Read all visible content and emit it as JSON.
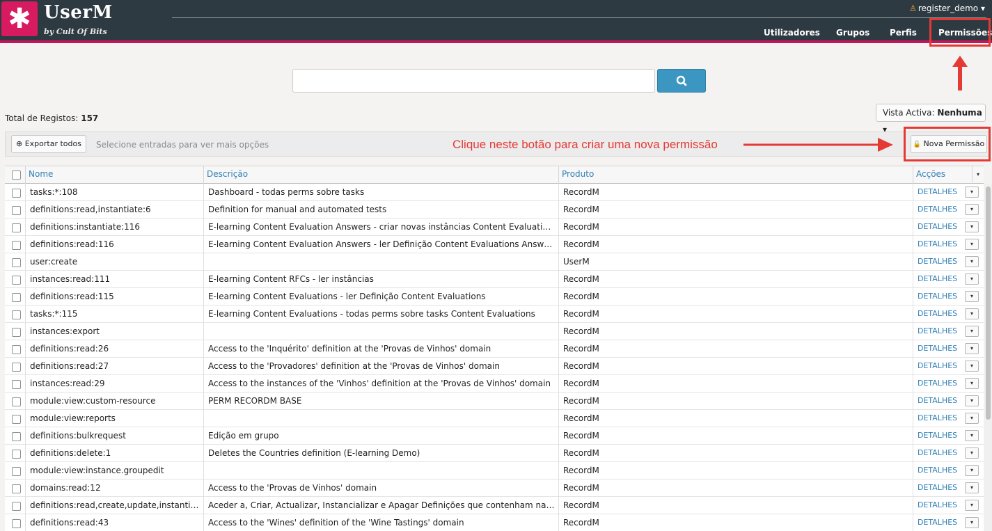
{
  "app": {
    "logo_glyph": "✱",
    "title": "UserM",
    "subtitle": "by Cult Of Bits",
    "user": "register_demo",
    "user_caret": "▾",
    "brand_color": "#d81b60",
    "header_color": "#2e3a42"
  },
  "nav": [
    {
      "label": "Utilizadores"
    },
    {
      "label": "Grupos"
    },
    {
      "label": "Perfis"
    },
    {
      "label": "Permissões"
    }
  ],
  "search": {
    "value": "",
    "placeholder": "",
    "icon": "search-icon"
  },
  "summary": {
    "total_label": "Total de Registos:",
    "total_value": "157"
  },
  "vista": {
    "label": "Vista Activa:",
    "value": "Nenhuma",
    "caret": "▾"
  },
  "toolbar": {
    "export_icon": "⊕",
    "export_label": "Exportar todos",
    "hint": "Selecione entradas para ver mais opções",
    "new_icon": "🔓",
    "new_label": "Nova Permissão"
  },
  "annotation": {
    "text": "Clique neste botão para criar uma nova permissão",
    "color": "#e53935"
  },
  "table": {
    "headers": {
      "name": "Nome",
      "description": "Descrição",
      "product": "Produto",
      "actions": "Acções"
    },
    "action_label": "DETALHES",
    "caret": "▾",
    "rows": [
      {
        "name": "tasks:*:108",
        "description": "Dashboard - todas perms sobre tasks",
        "product": "RecordM"
      },
      {
        "name": "definitions:read,instantiate:6",
        "description": "Definition for manual and automated tests",
        "product": "RecordM"
      },
      {
        "name": "definitions:instantiate:116",
        "description": "E-learning Content Evaluation Answers - criar novas instâncias Content Evaluations Answers",
        "product": "RecordM"
      },
      {
        "name": "definitions:read:116",
        "description": "E-learning Content Evaluation Answers - ler Definição Content Evaluations Answers",
        "product": "RecordM"
      },
      {
        "name": "user:create",
        "description": "",
        "product": "UserM"
      },
      {
        "name": "instances:read:111",
        "description": "E-learning Content RFCs - ler instâncias",
        "product": "RecordM"
      },
      {
        "name": "definitions:read:115",
        "description": "E-learning Content Evaluations - ler Definição Content Evaluations",
        "product": "RecordM"
      },
      {
        "name": "tasks:*:115",
        "description": "E-learning Content Evaluations - todas perms sobre tasks Content Evaluations",
        "product": "RecordM"
      },
      {
        "name": "instances:export",
        "description": "",
        "product": "RecordM"
      },
      {
        "name": "definitions:read:26",
        "description": "Access to the 'Inquérito' definition at the 'Provas de Vinhos' domain",
        "product": "RecordM"
      },
      {
        "name": "definitions:read:27",
        "description": "Access to the 'Provadores' definition at the 'Provas de Vinhos' domain",
        "product": "RecordM"
      },
      {
        "name": "instances:read:29",
        "description": "Access to the instances of the 'Vinhos' definition at the 'Provas de Vinhos' domain",
        "product": "RecordM"
      },
      {
        "name": "module:view:custom-resource",
        "description": "PERM RECORDM BASE",
        "product": "RecordM"
      },
      {
        "name": "module:view:reports",
        "description": "",
        "product": "RecordM"
      },
      {
        "name": "definitions:bulkrequest",
        "description": "Edição em grupo",
        "product": "RecordM"
      },
      {
        "name": "definitions:delete:1",
        "description": "Deletes the Countries definition (E-learning Demo)",
        "product": "RecordM"
      },
      {
        "name": "module:view:instance.groupedit",
        "description": "",
        "product": "RecordM"
      },
      {
        "name": "domains:read:12",
        "description": "Access to the 'Provas de Vinhos' domain",
        "product": "RecordM"
      },
      {
        "name": "definitions:read,create,update,instantiate,...",
        "description": "Aceder a, Criar, Actualizar, Instancializar e Apagar Definições que contenham na descrição...",
        "product": "RecordM"
      },
      {
        "name": "definitions:read:43",
        "description": "Access to the 'Wines' definition of the 'Wine Tastings' domain",
        "product": "RecordM"
      }
    ]
  }
}
